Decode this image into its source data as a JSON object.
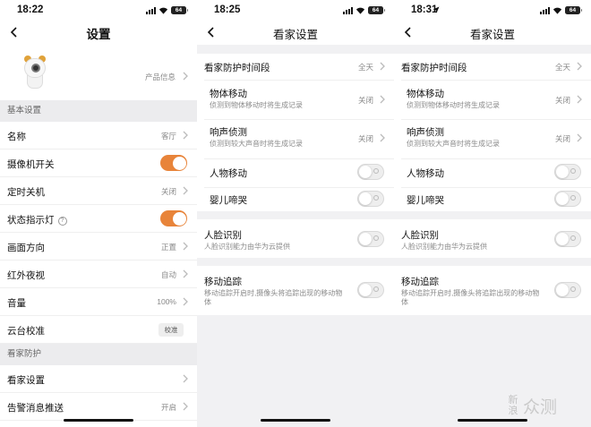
{
  "panels": [
    {
      "time": "18:22",
      "battery": "64",
      "title": "设置",
      "product_info": "产品信息",
      "section_basic": "基本设置",
      "rows": [
        {
          "label": "名称",
          "value": "客厅"
        },
        {
          "label": "摄像机开关",
          "toggle": "on"
        },
        {
          "label": "定时关机",
          "value": "关闭"
        },
        {
          "label": "状态指示灯",
          "toggle": "on",
          "help_icon": "?"
        },
        {
          "label": "画面方向",
          "value": "正置"
        },
        {
          "label": "红外夜视",
          "value": "自动"
        },
        {
          "label": "音量",
          "value": "100%"
        },
        {
          "label": "云台校准",
          "button": "校准"
        }
      ],
      "section_guard": "看家防护",
      "guard_rows": [
        {
          "label": "看家设置"
        },
        {
          "label": "告警消息推送",
          "value": "开启"
        }
      ]
    },
    {
      "time": "18:25",
      "battery": "64",
      "title": "看家设置",
      "period_label": "看家防护时间段",
      "period_value": "全天",
      "motion_label": "物体移动",
      "motion_sub": "侦测到物体移动时将生成记录",
      "motion_value": "关闭",
      "sound_label": "响声侦测",
      "sound_sub": "侦测到较大声音时将生成记录",
      "sound_value": "关闭",
      "human_label": "人物移动",
      "baby_label": "婴儿啼哭",
      "face_label": "人脸识别",
      "face_sub": "人脸识别能力由华为云提供",
      "track_label": "移动追踪",
      "track_sub": "移动追踪开启时,摄像头将追踪出现的移动物体"
    },
    {
      "time": "18:31",
      "battery": "64",
      "title": "看家设置",
      "period_label": "看家防护时间段",
      "period_value": "全天",
      "motion_label": "物体移动",
      "motion_sub": "侦测到物体移动时将生成记录",
      "motion_value": "关闭",
      "sound_label": "响声侦测",
      "sound_sub": "侦测到较大声音时将生成记录",
      "sound_value": "关闭",
      "human_label": "人物移动",
      "baby_label": "婴儿啼哭",
      "face_label": "人脸识别",
      "face_sub": "人脸识别能力由华为云提供",
      "track_label": "移动追踪",
      "track_sub": "移动追踪开启时,摄像头将追踪出现的移动物体"
    }
  ],
  "watermark": {
    "line1": "新",
    "line2": "浪",
    "brand": "众测"
  },
  "colors": {
    "accent": "#e8843a",
    "page_bg": "#f1f1f3",
    "section_bg": "#ececee"
  }
}
